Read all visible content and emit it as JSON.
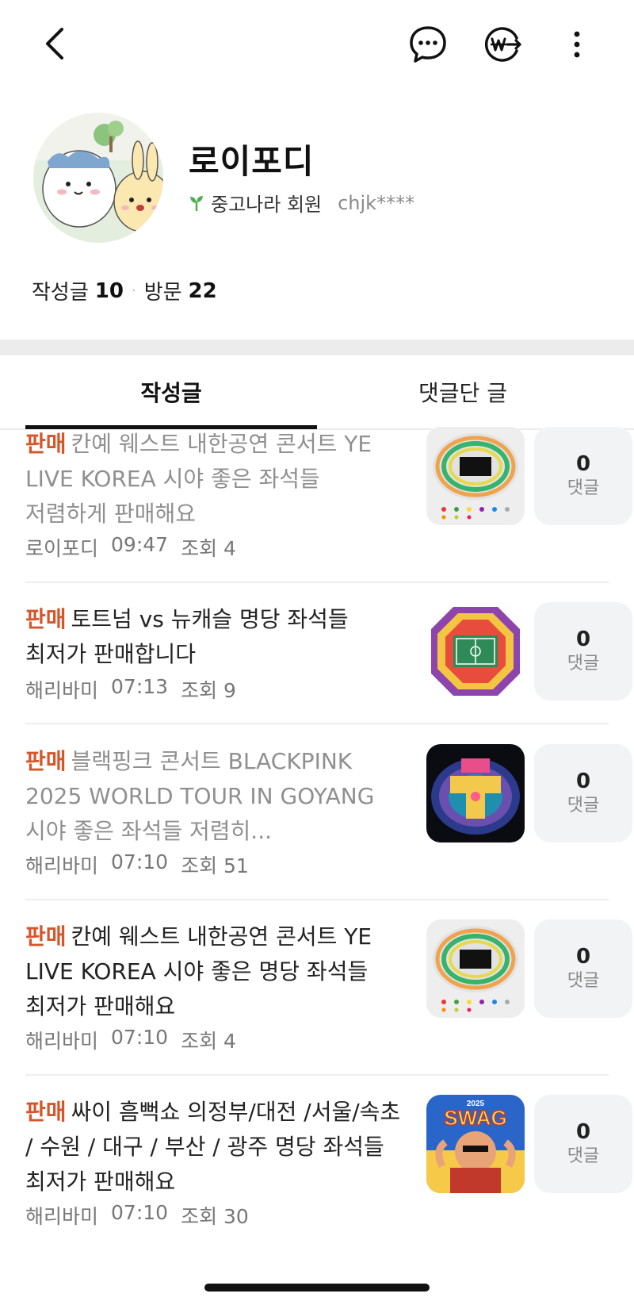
{
  "header": {
    "back_icon": "chevron-left-icon",
    "chat_icon": "chat-bubble-icon",
    "won_icon": "won-transfer-icon",
    "more_icon": "more-vertical-icon"
  },
  "profile": {
    "nickname": "로이포디",
    "member_type": "중고나라 회원",
    "masked_id": "chjk****",
    "stats": {
      "posts_label": "작성글",
      "posts_count": "10",
      "visits_label": "방문",
      "visits_count": "22"
    }
  },
  "tabs": [
    {
      "label": "작성글",
      "active": true
    },
    {
      "label": "댓글단 글",
      "active": false
    }
  ],
  "posts": [
    {
      "badge": "판매",
      "title": "칸예 웨스트 내한공연 콘서트 YE LIVE KOREA 시야 좋은 좌석들 저렴하게 판매해요",
      "author": "로이포디",
      "time": "09:47",
      "views": "조회 4",
      "comment_count": "0",
      "comment_label": "댓글",
      "dimmed": true
    },
    {
      "badge": "판매",
      "title": "토트넘 vs 뉴캐슬 명당 좌석들 최저가 판매합니다",
      "author": "해리바미",
      "time": "07:13",
      "views": "조회 9",
      "comment_count": "0",
      "comment_label": "댓글",
      "dimmed": false
    },
    {
      "badge": "판매",
      "title": "블랙핑크 콘서트 BLACKPINK 2025 WORLD TOUR IN GOYANG 시야 좋은 좌석들 저렴히...",
      "author": "해리바미",
      "time": "07:10",
      "views": "조회 51",
      "comment_count": "0",
      "comment_label": "댓글",
      "dimmed": true
    },
    {
      "badge": "판매",
      "title": "칸예 웨스트 내한공연 콘서트 YE LIVE KOREA 시야 좋은 명당 좌석들 최저가 판매해요",
      "author": "해리바미",
      "time": "07:10",
      "views": "조회 4",
      "comment_count": "0",
      "comment_label": "댓글",
      "dimmed": false
    },
    {
      "badge": "판매",
      "title": "싸이 흠뻑쇼 의정부/대전 /서울/속초 / 수원 / 대구 / 부산 / 광주 명당 좌석들 최저가 판매해요",
      "author": "해리바미",
      "time": "07:10",
      "views": "조회 30",
      "comment_count": "0",
      "comment_label": "댓글",
      "dimmed": false,
      "thumb_text": "SWAG",
      "thumb_year": "2025"
    }
  ],
  "colors": {
    "badge": "#d4562a",
    "comment_bg": "#f2f3f5",
    "divider": "#ececec"
  }
}
